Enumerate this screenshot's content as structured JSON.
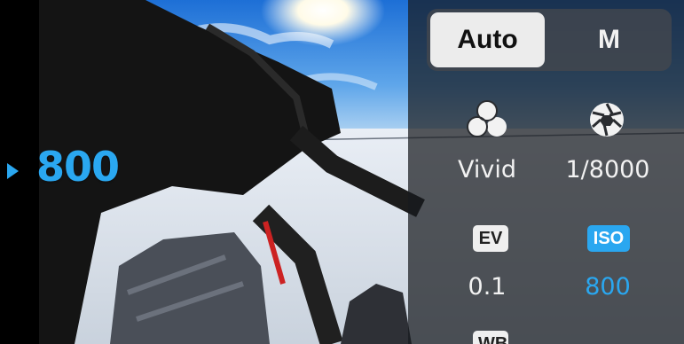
{
  "indicator": {
    "value": "800"
  },
  "mode_toggle": {
    "auto_label": "Auto",
    "manual_label": "M",
    "selected": "Auto"
  },
  "settings": {
    "color": {
      "icon": "color-filter-icon",
      "value": "Vivid"
    },
    "shutter": {
      "icon": "aperture-icon",
      "value": "1/8000"
    },
    "ev": {
      "label": "EV",
      "value": "0.1"
    },
    "iso": {
      "label": "ISO",
      "value": "800"
    },
    "wb": {
      "label": "WB"
    }
  },
  "colors": {
    "accent": "#2aa7f0",
    "panel": "#181a1e",
    "selected_segment": "#ececec"
  }
}
